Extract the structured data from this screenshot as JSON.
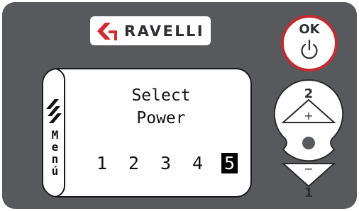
{
  "brand": {
    "name": "RAVELLI",
    "color": "#d62b2e"
  },
  "ok_button": {
    "label": "OK",
    "icon": "power-icon",
    "ring_color": "#c42a2f"
  },
  "display": {
    "menu_icon": "menu-stripes-icon",
    "menu_letters": [
      "M",
      "e",
      "n",
      "ú"
    ],
    "title_line1": "Select",
    "title_line2": "Power",
    "levels": [
      "1",
      "2",
      "3",
      "4",
      "5"
    ],
    "selected_level": "5"
  },
  "rocker": {
    "up_number": "2",
    "up_symbol": "+",
    "down_symbol": "−",
    "down_number": "1"
  },
  "colors": {
    "panel": "#57595d",
    "text": "#111111"
  }
}
